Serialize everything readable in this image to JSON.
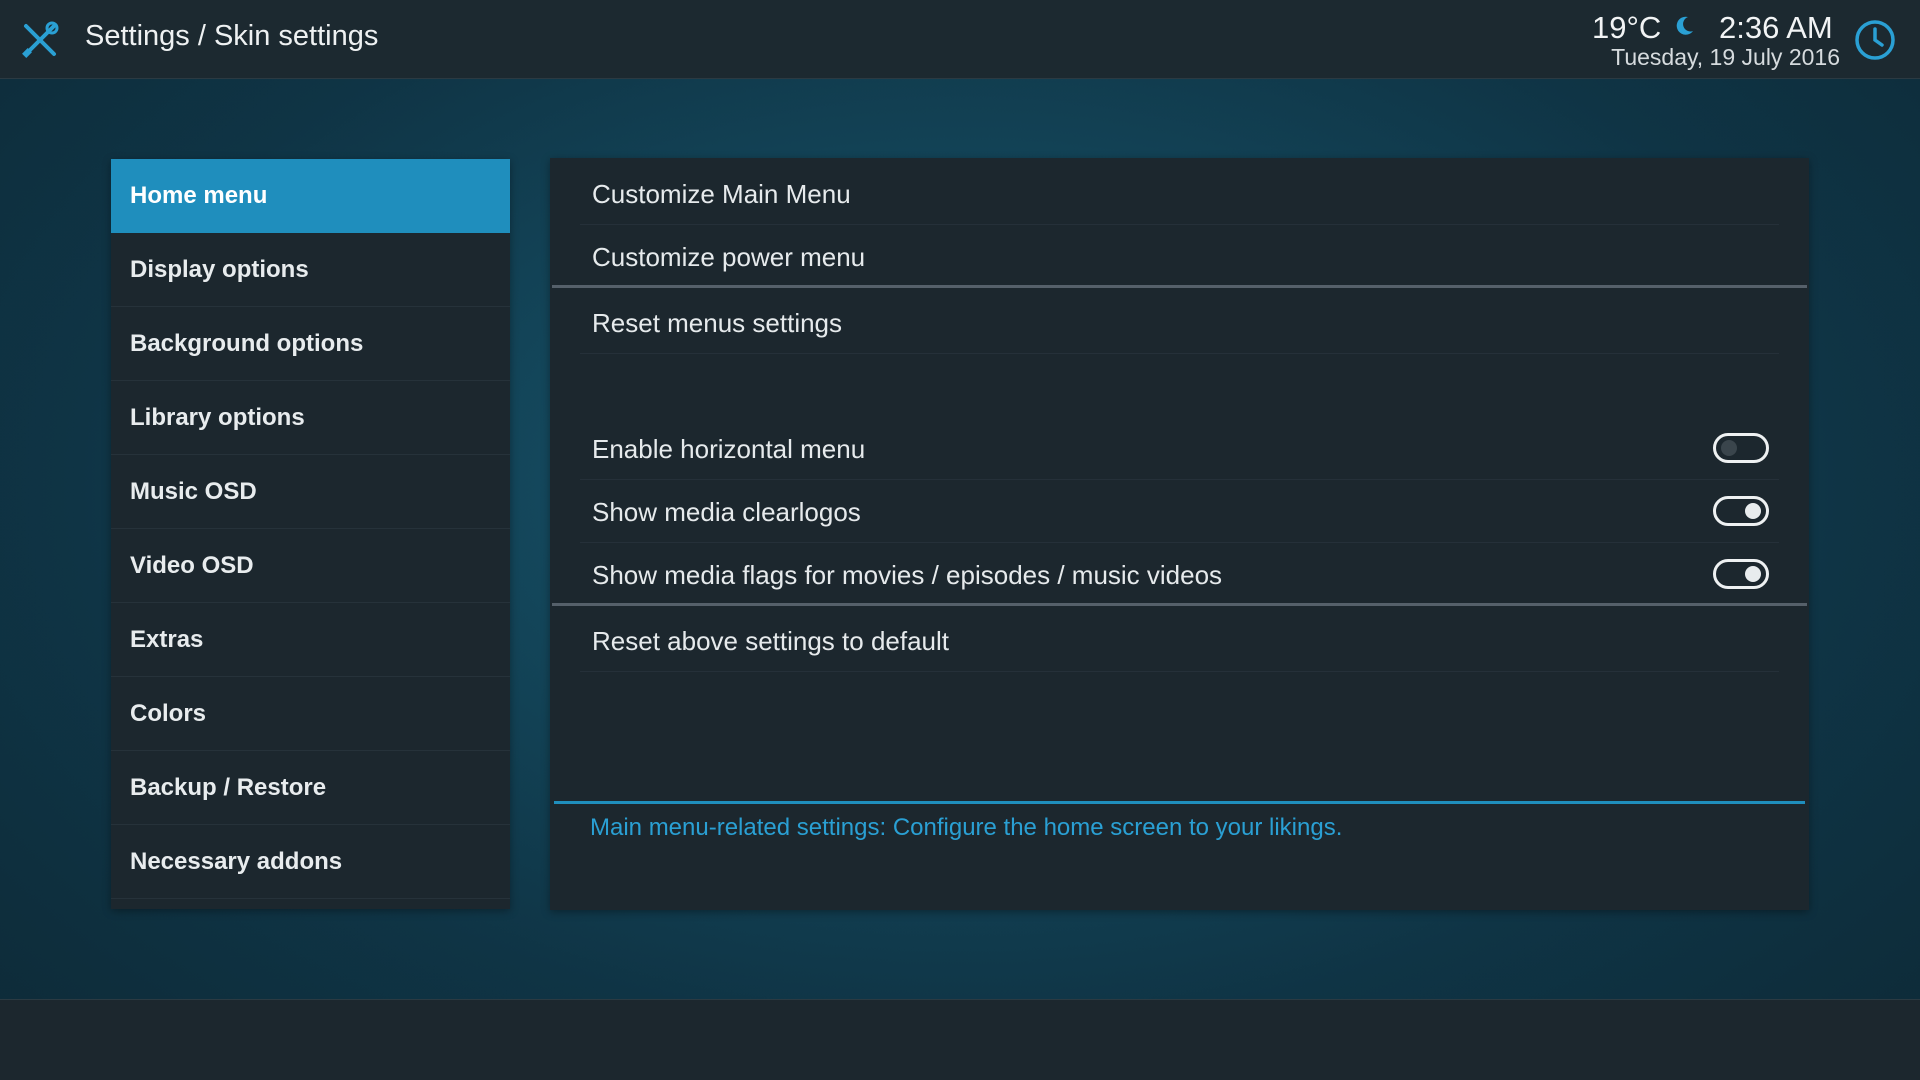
{
  "header": {
    "title": "Settings / Skin settings",
    "temperature": "19°C",
    "time": "2:36 AM",
    "date": "Tuesday, 19 July 2016",
    "icons": [
      "settings-tools-icon",
      "moon-icon",
      "clock-icon"
    ]
  },
  "sidebar": {
    "items": [
      {
        "label": "Home menu",
        "active": true
      },
      {
        "label": "Display options"
      },
      {
        "label": "Background options"
      },
      {
        "label": "Library options"
      },
      {
        "label": "Music OSD"
      },
      {
        "label": "Video OSD"
      },
      {
        "label": "Extras"
      },
      {
        "label": "Colors"
      },
      {
        "label": "Backup / Restore"
      },
      {
        "label": "Necessary addons"
      }
    ]
  },
  "main": {
    "customize_main_menu": "Customize Main Menu",
    "customize_power_menu": "Customize power menu",
    "reset_menus_settings": "Reset menus settings",
    "enable_horizontal_menu": {
      "label": "Enable horizontal menu",
      "enabled": false
    },
    "show_media_clearlogos": {
      "label": "Show media clearlogos",
      "enabled": true
    },
    "show_media_flags": {
      "label": "Show media flags for movies / episodes / music videos",
      "enabled": true
    },
    "reset_above_settings": "Reset above settings to default",
    "info_text": "Main menu-related settings: Configure the home screen to your likings."
  },
  "colors": {
    "accent": "#1f8ebd",
    "info_text": "#2aa0d4",
    "panel": "#1c272e",
    "header": "#1c2930"
  }
}
